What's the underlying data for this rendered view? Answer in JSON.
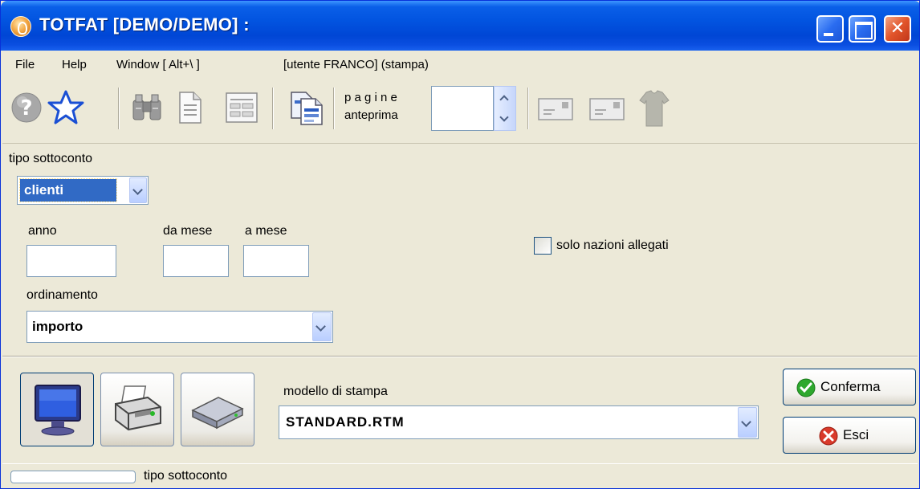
{
  "window": {
    "title": "TOTFAT [DEMO/DEMO] :",
    "close_glyph": "✕"
  },
  "menu": {
    "file": "File",
    "help": "Help",
    "window": "Window [ Alt+\\ ]",
    "user": "[utente FRANCO] (stampa)"
  },
  "toolbar": {
    "pages_label": "p a g i n e",
    "preview_label": "anteprima",
    "pages_value": "",
    "icons": [
      "help-icon",
      "favorite-star-icon",
      "binoculars-icon",
      "document-icon",
      "form-icon",
      "copy-pages-icon",
      "envelope-icon",
      "envelope-icon",
      "shirt-icon"
    ]
  },
  "form": {
    "tipo_sottoconto_label": "tipo sottoconto",
    "tipo_sottoconto_value": "clienti",
    "anno_label": "anno",
    "anno_value": "",
    "da_mese_label": "da mese",
    "da_mese_value": "",
    "a_mese_label": "a mese",
    "a_mese_value": "",
    "solo_nazioni_label": "solo nazioni allegati",
    "solo_nazioni_checked": false,
    "ordinamento_label": "ordinamento",
    "ordinamento_value": "importo"
  },
  "output": {
    "modello_label": "modello di stampa",
    "modello_value": "STANDARD.RTM",
    "selected_target": "screen",
    "targets": [
      "monitor-icon",
      "printer-icon",
      "disk-drive-icon"
    ]
  },
  "actions": {
    "confirm_label": "Conferma",
    "exit_label": "Esci"
  },
  "status": {
    "text": "tipo sottoconto",
    "progress": 0
  },
  "colors": {
    "titlebar": "#0054e3",
    "face": "#ece9d8",
    "selection": "#316ac5",
    "confirm_green": "#2ea82e",
    "exit_red": "#d93a2b"
  }
}
